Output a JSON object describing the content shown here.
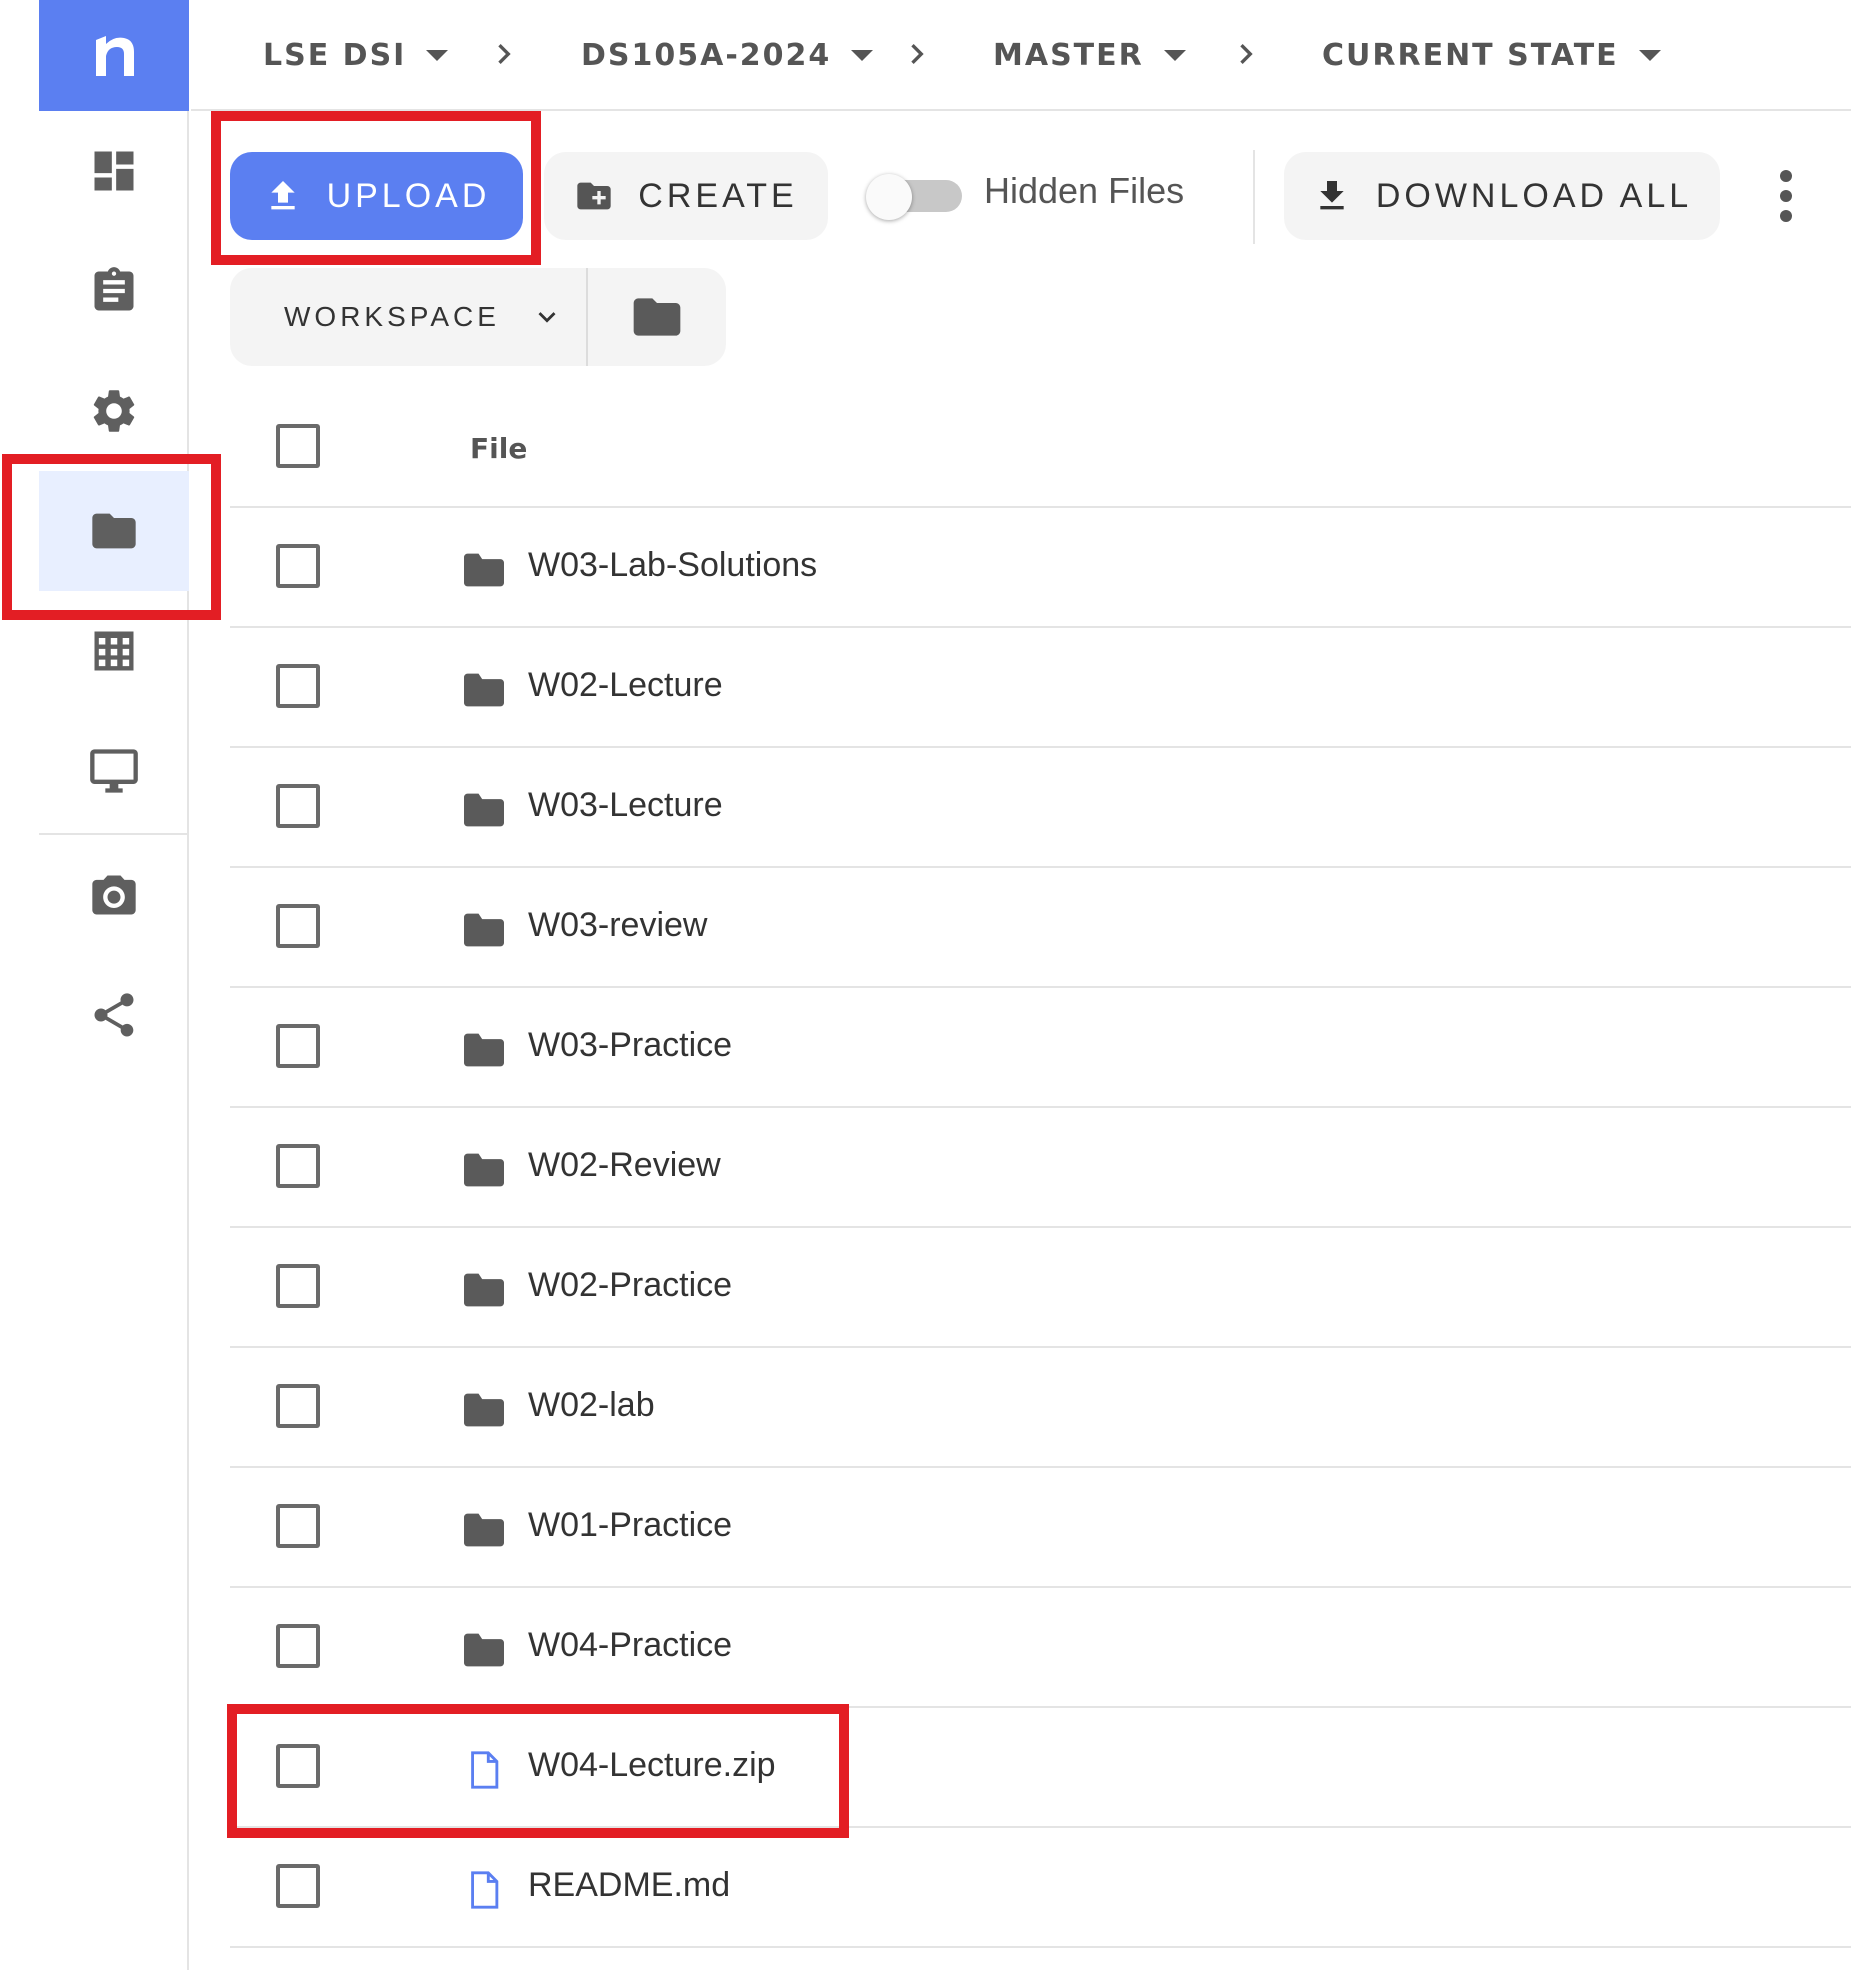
{
  "breadcrumb": [
    {
      "label": "LSE DSI"
    },
    {
      "label": "DS105A-2024"
    },
    {
      "label": "MASTER"
    },
    {
      "label": "CURRENT STATE"
    }
  ],
  "sidebar": {
    "logo": "n",
    "items": [
      {
        "icon": "dashboard-icon"
      },
      {
        "icon": "clipboard-icon"
      },
      {
        "icon": "gear-icon"
      },
      {
        "icon": "folder-icon",
        "active": true
      },
      {
        "icon": "table-grid-icon"
      },
      {
        "icon": "monitor-icon"
      },
      {
        "icon": "camera-icon"
      },
      {
        "icon": "share-icon"
      }
    ]
  },
  "toolbar": {
    "upload_label": "UPLOAD",
    "create_label": "CREATE",
    "hidden_files_label": "Hidden Files",
    "hidden_files_on": false,
    "download_all_label": "DOWNLOAD ALL"
  },
  "workspace": {
    "selected": "WORKSPACE"
  },
  "table": {
    "header": "File",
    "rows": [
      {
        "name": "W03-Lab-Solutions",
        "type": "folder"
      },
      {
        "name": "W02-Lecture",
        "type": "folder"
      },
      {
        "name": "W03-Lecture",
        "type": "folder"
      },
      {
        "name": "W03-review",
        "type": "folder"
      },
      {
        "name": "W03-Practice",
        "type": "folder"
      },
      {
        "name": "W02-Review",
        "type": "folder"
      },
      {
        "name": "W02-Practice",
        "type": "folder"
      },
      {
        "name": "W02-lab",
        "type": "folder"
      },
      {
        "name": "W01-Practice",
        "type": "folder"
      },
      {
        "name": "W04-Practice",
        "type": "folder"
      },
      {
        "name": "W04-Lecture.zip",
        "type": "file"
      },
      {
        "name": "README.md",
        "type": "file"
      }
    ]
  },
  "colors": {
    "accent": "#5b7ff1",
    "highlight": "#e31e24",
    "active_nav_bg": "#e8efff"
  }
}
